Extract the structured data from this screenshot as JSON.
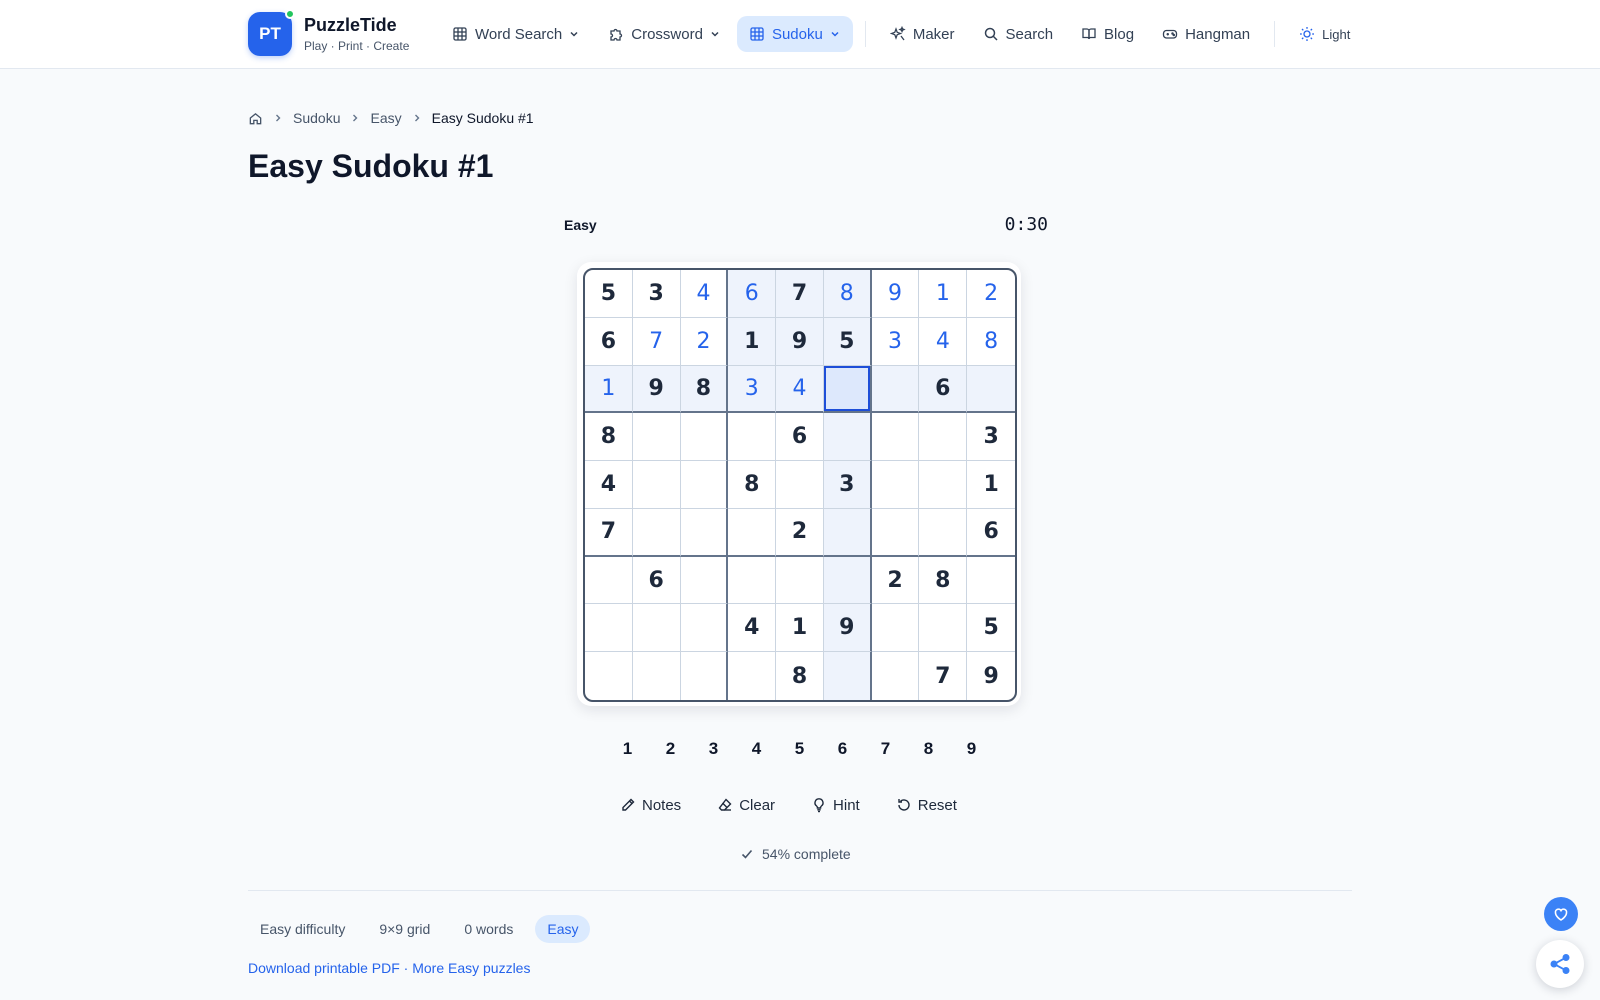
{
  "brand": {
    "logo": "PT",
    "name": "PuzzleTide",
    "tagline": "Play · Print · Create"
  },
  "nav": {
    "word_search": "Word Search",
    "crossword": "Crossword",
    "sudoku": "Sudoku",
    "maker": "Maker",
    "search": "Search",
    "blog": "Blog",
    "hangman": "Hangman",
    "theme": "Light"
  },
  "breadcrumb": {
    "level1": "Sudoku",
    "level2": "Easy",
    "current": "Easy Sudoku #1"
  },
  "page_title": "Easy Sudoku #1",
  "game": {
    "difficulty": "Easy",
    "timer": "0:30",
    "selected_cell": {
      "row": 3,
      "col": 6
    },
    "grid": [
      [
        "5",
        "3",
        "4",
        "6",
        "7",
        "8",
        "9",
        "1",
        "2"
      ],
      [
        "6",
        "7",
        "2",
        "1",
        "9",
        "5",
        "3",
        "4",
        "8"
      ],
      [
        "1",
        "9",
        "8",
        "3",
        "4",
        "",
        "",
        "6",
        ""
      ],
      [
        "8",
        "",
        "",
        "",
        "6",
        "",
        "",
        "",
        "3"
      ],
      [
        "4",
        "",
        "",
        "8",
        "",
        "3",
        "",
        "",
        "1"
      ],
      [
        "7",
        "",
        "",
        "",
        "2",
        "",
        "",
        "",
        "6"
      ],
      [
        "",
        "6",
        "",
        "",
        "",
        "",
        "2",
        "8",
        ""
      ],
      [
        "",
        "",
        "",
        "4",
        "1",
        "9",
        "",
        "",
        "5"
      ],
      [
        "",
        "",
        "",
        "",
        "8",
        "",
        "",
        "7",
        "9"
      ]
    ],
    "user_entries": [
      [
        0,
        0,
        1,
        1,
        0,
        1,
        1,
        1,
        1
      ],
      [
        0,
        1,
        1,
        0,
        0,
        0,
        1,
        1,
        1
      ],
      [
        1,
        0,
        0,
        1,
        1,
        0,
        0,
        0,
        0
      ],
      [
        0,
        0,
        0,
        0,
        0,
        0,
        0,
        0,
        0
      ],
      [
        0,
        0,
        0,
        0,
        0,
        0,
        0,
        0,
        0
      ],
      [
        0,
        0,
        0,
        0,
        0,
        0,
        0,
        0,
        0
      ],
      [
        0,
        0,
        0,
        0,
        0,
        0,
        0,
        0,
        0
      ],
      [
        0,
        0,
        0,
        0,
        0,
        0,
        0,
        0,
        0
      ],
      [
        0,
        0,
        0,
        0,
        0,
        0,
        0,
        0,
        0
      ]
    ],
    "numbers": [
      "1",
      "2",
      "3",
      "4",
      "5",
      "6",
      "7",
      "8",
      "9"
    ],
    "tools": {
      "notes": "Notes",
      "clear": "Clear",
      "hint": "Hint",
      "reset": "Reset"
    },
    "progress": "54% complete"
  },
  "footer_tags": {
    "difficulty": "Easy difficulty",
    "grid": "9×9 grid",
    "words": "0 words",
    "level": "Easy"
  },
  "links": {
    "pdf": "Download printable PDF",
    "separator": " · ",
    "more": "More Easy puzzles"
  },
  "colors": {
    "accent": "#2563eb",
    "user_digit": "#2563eb",
    "given_digit": "#1e293b",
    "highlight": "#eef3fc",
    "selected": "#dde8fc"
  },
  "icons": [
    "home-icon",
    "chevron-right-icon",
    "grid-icon",
    "puzzle-icon",
    "sparkles-icon",
    "search-icon",
    "book-icon",
    "gamepad-icon",
    "sun-icon",
    "pencil-icon",
    "eraser-icon",
    "lightbulb-icon",
    "reset-icon",
    "check-icon",
    "heart-icon",
    "share-icon"
  ]
}
